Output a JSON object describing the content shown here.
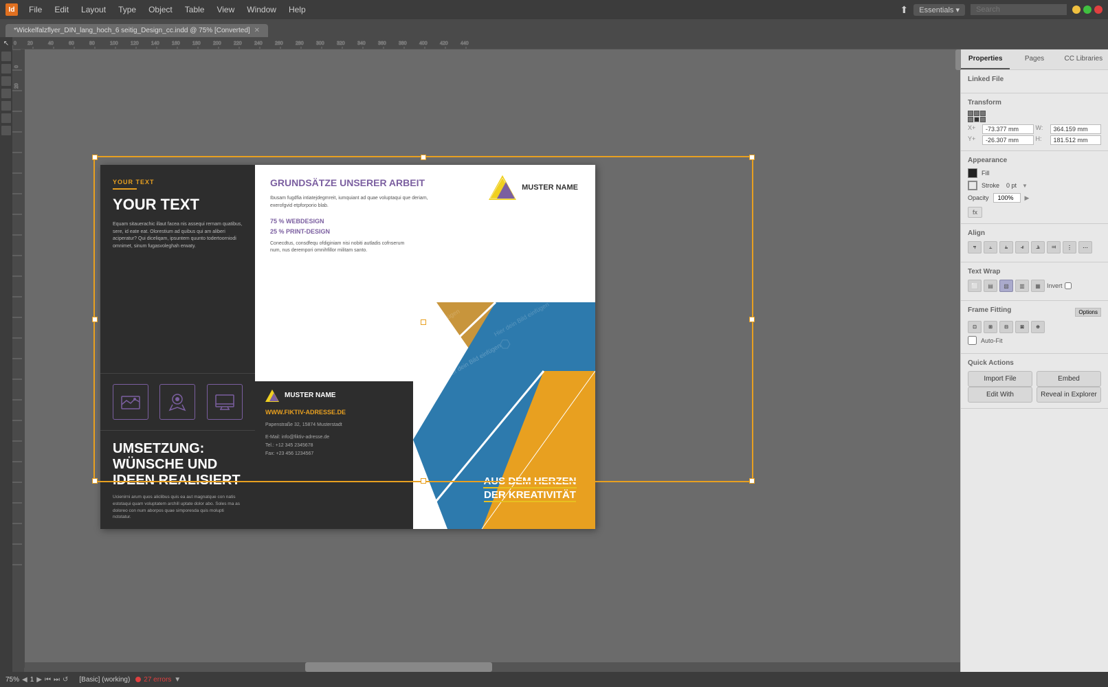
{
  "app": {
    "title": "Adobe InDesign",
    "menu_items": [
      "File",
      "Edit",
      "Layout",
      "Type",
      "Object",
      "Table",
      "View",
      "Window",
      "Help"
    ],
    "tab_title": "*Wickelfalzflyer_DIN_lang_hoch_6 seitig_Design_cc.indd @ 75% [Converted]",
    "essentials_label": "Essentials ▾",
    "search_placeholder": "Search"
  },
  "right_panel": {
    "tabs": [
      "Properties",
      "Pages",
      "CC Libraries"
    ],
    "active_tab": "Properties",
    "linked_file_label": "Linked File",
    "transform_label": "Transform",
    "x_label": "X+",
    "x_value": "-73.377 mm",
    "y_label": "Y+",
    "y_value": "-26.307 mm",
    "w_label": "W:",
    "w_value": "364.159 mm",
    "h_label": "H:",
    "h_value": "181.512 mm",
    "appearance_label": "Appearance",
    "fill_label": "Fill",
    "stroke_label": "Stroke",
    "stroke_value": "0 pt",
    "opacity_label": "Opacity",
    "opacity_value": "100%",
    "fx_label": "fx",
    "align_label": "Align",
    "text_wrap_label": "Text Wrap",
    "invert_label": "Invert",
    "frame_fitting_label": "Frame Fitting",
    "options_label": "Options",
    "auto_fit_label": "Auto-Fit",
    "quick_actions_label": "Quick Actions",
    "import_file_label": "Import File",
    "embed_label": "Embed",
    "edit_with_label": "Edit With",
    "reveal_in_explorer_label": "Reveal in Explorer"
  },
  "flyer": {
    "your_text": "YOUR TEXT",
    "body_text": "Equam sitauerachic illaut facea nis assequi rernam quatibus, sere, id eate eat. Olorestium ad quibus qui am aliberi aciperatur? Qui diceliqam, ipsuntem quunto todertoorniodi omnimet, sinum fugasvoleghah erwaty.",
    "icons": [
      "landscape-icon",
      "badge-icon",
      "monitor-icon"
    ],
    "umsetzung_title": "UMSETZUNG: WÜNSCHE UND IDEEN REALISIERT",
    "umsetzung_body": "Ucienirni arum quos aliclibus quis ea aut magnatque con natis estotaqui quam voluptatem archill uptate dolor abo. Soles ma as doloreo con num aborpos quae simporesda quis molupti nctotatur.",
    "grundsatze_heading": "GRUNDSÄTZE UNSERER ARBEIT",
    "muster_name": "MUSTER NAME",
    "grundsatze_body": "Ibusam fugdfia intiatejdegmreit, iumquiant ad quae voluptaqui que deriam, exerofgvid etpforporio blab.",
    "percent_heading_1": "75 % WEBDESIGN",
    "percent_heading_2": "25 % PRINT-DESIGN",
    "details_body": "Conecdtus, consdfequ ofdiginiam nisi nobiti autladis cofnserum num, nus derempori omnihfillor militam santo.",
    "contact_name": "MUSTER NAME",
    "contact_website": "WWW.FIKTIV-ADRESSE.DE",
    "contact_address": "Papenstraße 32, 15874 Musterstadt",
    "contact_email": "E-Mail: info@fiktiv-adresse.de",
    "contact_tel": "Tel.: +12 345 2345678",
    "contact_fax": "Fax: +23 456 1234567",
    "aus_dem_heading": "AUS DEM HERZEN DER KREATIVITÄT",
    "watermark_text": "Hier dein Bild einfügen"
  },
  "bottom_bar": {
    "zoom": "75%",
    "page": "1",
    "style": "[Basic] (working)",
    "errors": "27 errors"
  }
}
